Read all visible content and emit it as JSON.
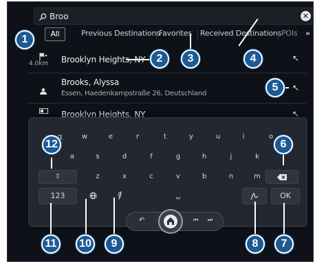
{
  "search": {
    "value": "Broo",
    "clear_icon": "close-circle-icon"
  },
  "tabs": [
    {
      "label": "All",
      "active": true
    },
    {
      "label": "Previous Destinations",
      "active": false
    },
    {
      "label": "Favorites",
      "active": false
    },
    {
      "label": "Received Destinations",
      "active": false
    },
    {
      "label": "POIs",
      "active": false
    }
  ],
  "tabs_more": "»",
  "results": [
    {
      "title": "Brooklyn Heights, NY",
      "subtitle": "",
      "distance": "4.0km",
      "icon": "flag-route-icon",
      "action": "↖"
    },
    {
      "title": "Brooks, Alyssa",
      "subtitle": "Essen, Haedenkampstraße 26, Deutschland",
      "distance": "",
      "icon": "contact-icon",
      "action": "↖"
    },
    {
      "title": "Brooklyn Heights, NY",
      "subtitle": "",
      "distance": "",
      "icon": "map-icon",
      "action": "↖"
    }
  ],
  "keyboard": {
    "row1": [
      "q",
      "w",
      "e",
      "r",
      "t",
      "y",
      "u",
      "i",
      "o"
    ],
    "row2": [
      "a",
      "s",
      "d",
      "f",
      "g",
      "h",
      "j",
      "k",
      "l"
    ],
    "row3": [
      "z",
      "x",
      "c",
      "v",
      "b",
      "n",
      "m"
    ],
    "shift_symbol": "⇧",
    "space_symbol": "␣",
    "numbers_label": "123",
    "ok_label": "OK",
    "backspace_icon": "backspace-icon",
    "globe_icon": "globe-icon",
    "voice_icon": "voice-input-icon",
    "handwriting_icon": "handwriting-icon"
  },
  "nav": {
    "back_symbol": "↶",
    "prev_symbol": "⏮",
    "next_symbol": "⏭",
    "home_icon": "home-icon"
  },
  "callouts": [
    "1",
    "2",
    "3",
    "4",
    "5",
    "6",
    "7",
    "8",
    "9",
    "10",
    "11",
    "12"
  ],
  "colors": {
    "callout_fill": "#1d5a93",
    "screen_bg": "#0e1218",
    "keyboard_bg": "#232830"
  }
}
